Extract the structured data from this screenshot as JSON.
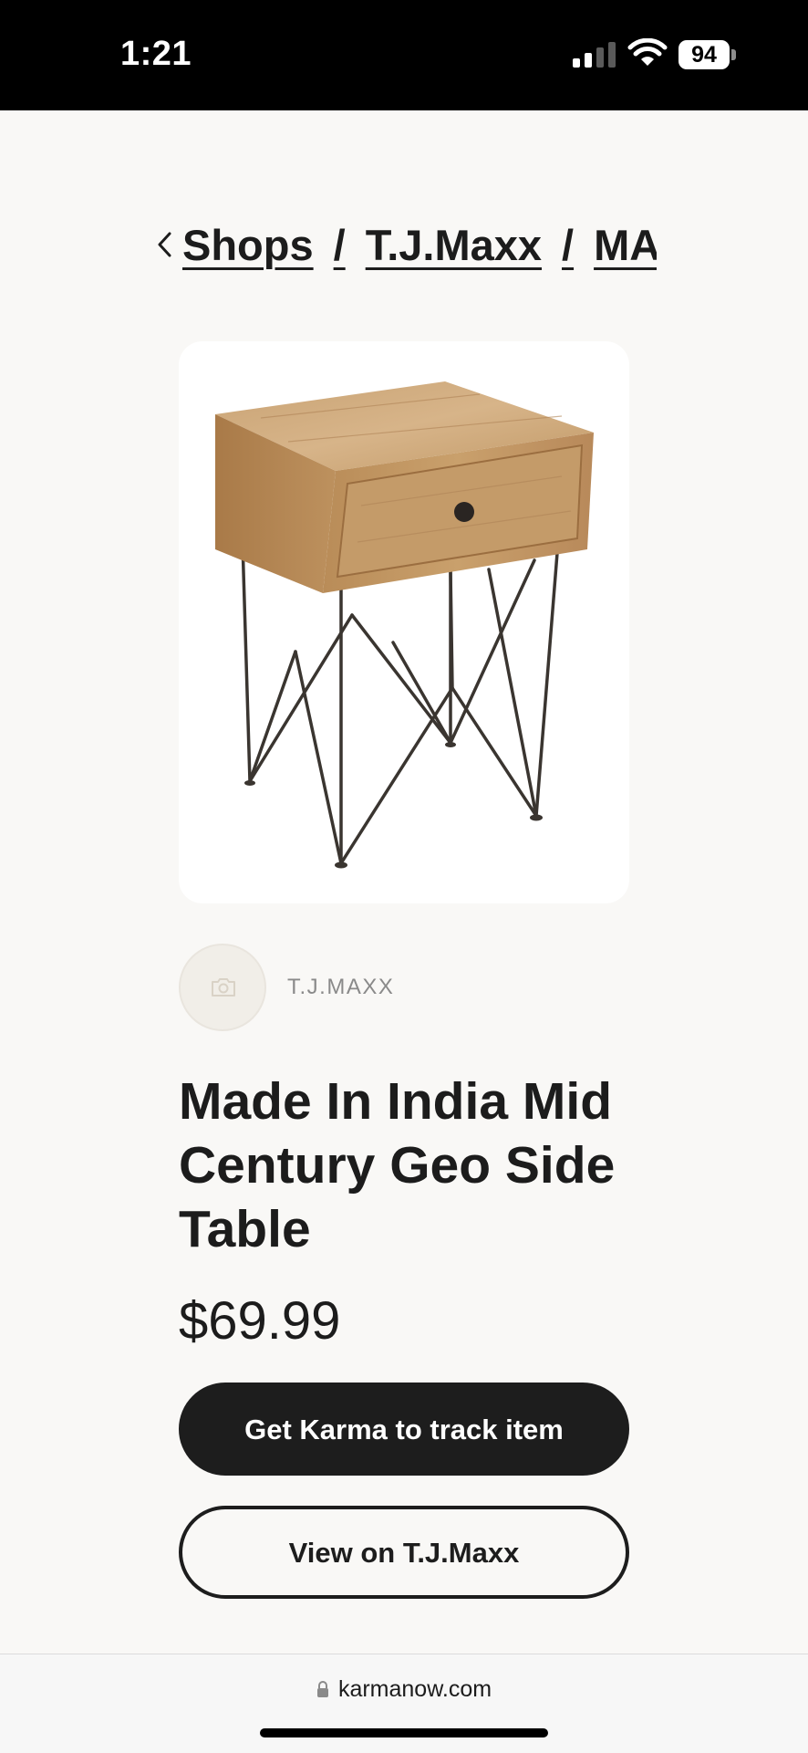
{
  "status_bar": {
    "time": "1:21",
    "battery_level": "94",
    "signal_bars_filled": 2,
    "signal_bars_total": 4
  },
  "breadcrumb": {
    "items": [
      "Shops",
      "T.J.Maxx",
      "MADE IN INDIA MID CENTURY GEO SIDE TABLE"
    ],
    "separator": "/"
  },
  "product": {
    "image_icon": "side-table-photo",
    "shop_name": "T.J.MAXX",
    "title": "Made In India Mid Century Geo Side Table",
    "price": "$69.99"
  },
  "actions": {
    "track_label": "Get Karma to track item",
    "view_label": "View on T.J.Maxx"
  },
  "browser": {
    "url": "karmanow.com"
  },
  "colors": {
    "background": "#f9f8f6",
    "primary_button": "#1d1d1d",
    "text": "#1c1c1c",
    "muted_text": "#8a8a8a"
  }
}
